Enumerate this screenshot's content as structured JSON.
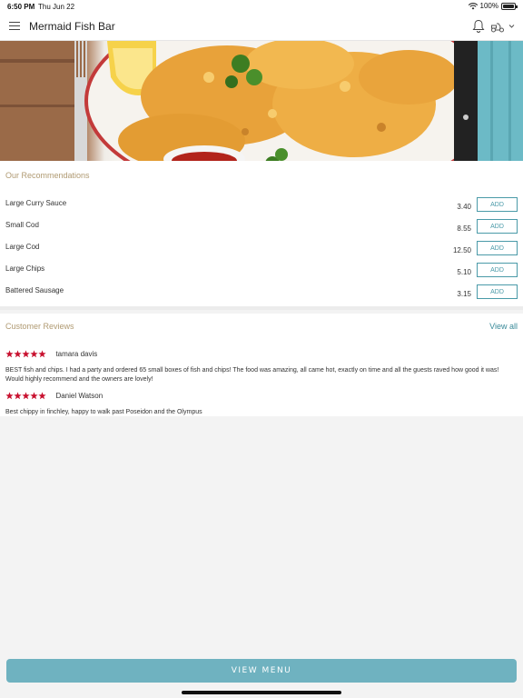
{
  "status_bar": {
    "time": "6:50 PM",
    "date": "Thu Jun 22",
    "battery": "100%"
  },
  "header": {
    "title": "Mermaid Fish Bar",
    "icons": [
      "menu-icon",
      "bell-icon",
      "scooter-icon",
      "chevron-down-icon"
    ]
  },
  "hero": {
    "image_description_icon": "fish-and-chips-image"
  },
  "recommendations": {
    "title": "Our Recommendations",
    "items": [
      {
        "name": "Large Curry Sauce",
        "price": "3.40",
        "action": "ADD"
      },
      {
        "name": "Small Cod",
        "price": "8.55",
        "action": "ADD"
      },
      {
        "name": "Large Cod",
        "price": "12.50",
        "action": "ADD"
      },
      {
        "name": "Large Chips",
        "price": "5.10",
        "action": "ADD"
      },
      {
        "name": "Battered Sausage",
        "price": "3.15",
        "action": "ADD"
      }
    ]
  },
  "reviews": {
    "title": "Customer Reviews",
    "view_all": "View all",
    "items": [
      {
        "rating": 5,
        "reviewer": "tamara davis",
        "text": "BEST fish and chips. I had a party and ordered 65 small boxes of fish and chips! The food was amazing, all came hot, exactly on time and all the guests raved how good it was! Would highly recommend and the owners are lovely!"
      },
      {
        "rating": 5,
        "reviewer": "Daniel Watson",
        "text": "Best chippy in finchley, happy to walk past Poseidon and the Olympus"
      }
    ]
  },
  "footer": {
    "view_menu": "VIEW MENU"
  },
  "colors": {
    "accent": "#4a9aa8",
    "button": "#6fb2c0",
    "section_title": "#b09a72",
    "star": "#c8102e"
  }
}
